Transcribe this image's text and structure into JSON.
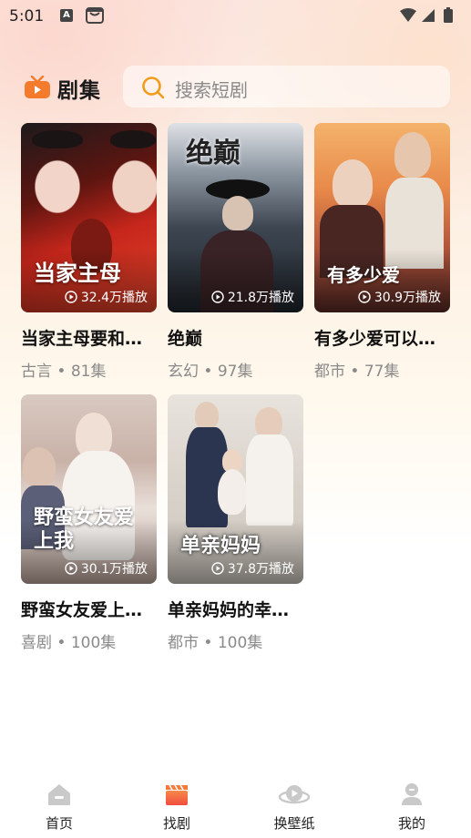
{
  "status_bar": {
    "time": "5:01",
    "a_badge": "A"
  },
  "header": {
    "brand": "剧集",
    "search_placeholder": "搜索短剧"
  },
  "dramas": [
    {
      "title": "当家主母要和…",
      "genre": "古言",
      "episodes": "81集",
      "plays": "32.4万播放",
      "poster_text": "当家主母"
    },
    {
      "title": "绝巅",
      "genre": "玄幻",
      "episodes": "97集",
      "plays": "21.8万播放",
      "poster_text": "绝巅"
    },
    {
      "title": "有多少爱可以…",
      "genre": "都市",
      "episodes": "77集",
      "plays": "30.9万播放",
      "poster_text": "有多少爱"
    },
    {
      "title": "野蛮女友爱上…",
      "genre": "喜剧",
      "episodes": "100集",
      "plays": "30.1万播放",
      "poster_text": "野蛮女友爱上我"
    },
    {
      "title": "单亲妈妈的幸…",
      "genre": "都市",
      "episodes": "100集",
      "plays": "37.8万播放",
      "poster_text": "单亲妈妈"
    }
  ],
  "tabs": [
    {
      "label": "首页",
      "icon": "home-icon"
    },
    {
      "label": "找剧",
      "icon": "clapperboard-icon",
      "active": true
    },
    {
      "label": "换壁纸",
      "icon": "wallpaper-icon"
    },
    {
      "label": "我的",
      "icon": "profile-icon"
    }
  ],
  "colors": {
    "accent": "#f47a2c",
    "search_icon": "#f39a1a"
  }
}
